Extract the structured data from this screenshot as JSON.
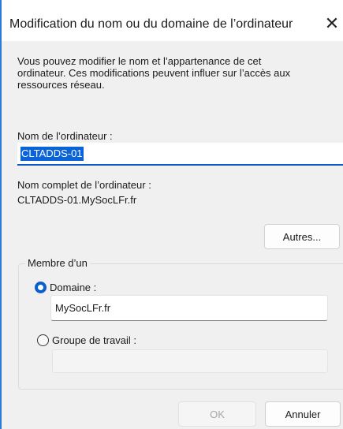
{
  "dialog": {
    "title": "Modification du nom ou du domaine de l’ordinateur",
    "close_glyph": "✕",
    "intro_line1": "Vous pouvez modifier le nom et l’appartenance de cet",
    "intro_line2": "ordinateur. Ces modifications peuvent influer sur l’accès aux",
    "intro_line3": "ressources réseau.",
    "computer_name_label": "Nom de l’ordinateur :",
    "computer_name_value": "CLTADDS-01",
    "full_name_label": "Nom complet de l’ordinateur :",
    "full_name_value": "CLTADDS-01.MySocLFr.fr",
    "more_button": "Autres...",
    "member_of": {
      "legend": "Membre d’un",
      "domain_label": "Domaine :",
      "domain_value": "MySocLFr.fr",
      "domain_selected": true,
      "workgroup_label": "Groupe de travail :",
      "workgroup_value": ""
    },
    "ok_button": "OK",
    "cancel_button": "Annuler"
  },
  "colors": {
    "accent": "#0a63d8",
    "window_border": "#2a7bd8"
  }
}
